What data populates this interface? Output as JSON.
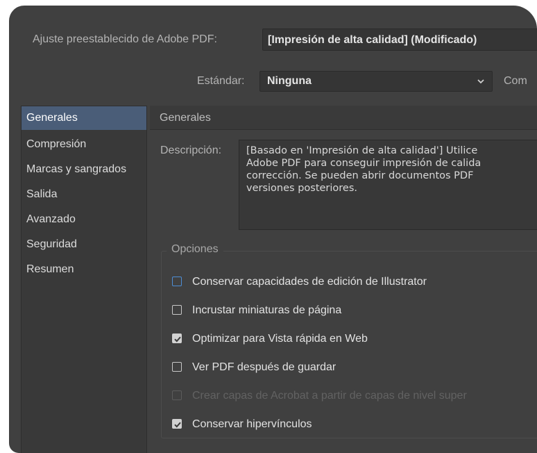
{
  "preset": {
    "label": "Ajuste preestablecido de Adobe PDF:",
    "value": "[Impresión de alta calidad] (Modificado)"
  },
  "standard": {
    "label": "Estándar:",
    "value": "Ninguna",
    "compat_label_partial": "Com"
  },
  "sidebar": {
    "items": [
      {
        "label": "Generales",
        "active": true
      },
      {
        "label": "Compresión"
      },
      {
        "label": "Marcas y sangrados"
      },
      {
        "label": "Salida"
      },
      {
        "label": "Avanzado"
      },
      {
        "label": "Seguridad"
      },
      {
        "label": "Resumen"
      }
    ]
  },
  "section": {
    "title": "Generales"
  },
  "description": {
    "label": "Descripción:",
    "lines": [
      "[Basado en 'Impresión de alta calidad'] Utilice",
      "Adobe PDF para conseguir impresión de calida",
      "corrección. Se pueden abrir documentos PDF",
      "versiones posteriores."
    ]
  },
  "options": {
    "title": "Opciones",
    "items": [
      {
        "label": "Conservar capacidades de edición de Illustrator",
        "checked": false,
        "focused": true
      },
      {
        "label": "Incrustar miniaturas de página",
        "checked": false
      },
      {
        "label": "Optimizar para Vista rápida en Web",
        "checked": true
      },
      {
        "label": "Ver PDF después de guardar",
        "checked": false
      },
      {
        "label": "Crear capas de Acrobat a partir de capas de nivel super",
        "checked": false,
        "disabled": true
      },
      {
        "label": "Conservar hipervínculos",
        "checked": true
      }
    ]
  },
  "colors": {
    "panel": "#404040",
    "selected": "#4a5d78",
    "focus": "#4d8ed6"
  }
}
